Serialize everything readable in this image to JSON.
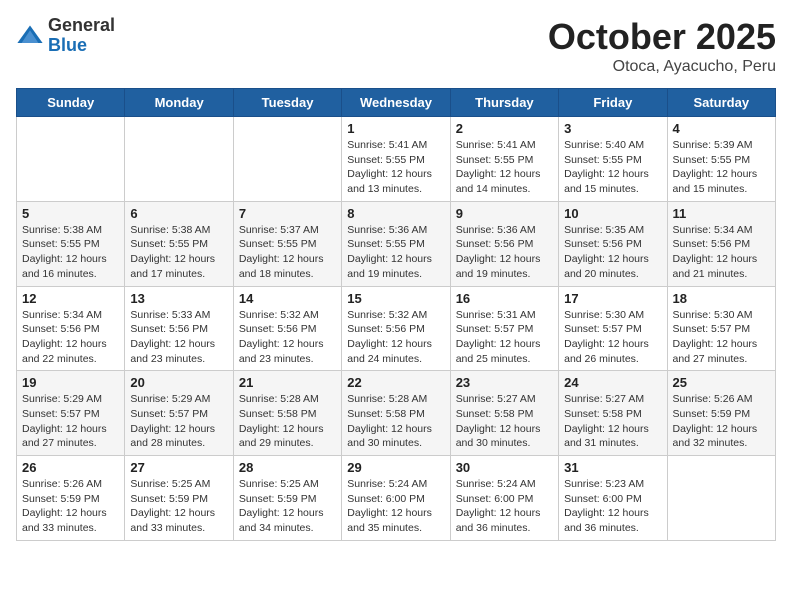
{
  "header": {
    "logo_general": "General",
    "logo_blue": "Blue",
    "title": "October 2025",
    "subtitle": "Otoca, Ayacucho, Peru"
  },
  "weekdays": [
    "Sunday",
    "Monday",
    "Tuesday",
    "Wednesday",
    "Thursday",
    "Friday",
    "Saturday"
  ],
  "weeks": [
    [
      {
        "day": "",
        "info": ""
      },
      {
        "day": "",
        "info": ""
      },
      {
        "day": "",
        "info": ""
      },
      {
        "day": "1",
        "info": "Sunrise: 5:41 AM\nSunset: 5:55 PM\nDaylight: 12 hours\nand 13 minutes."
      },
      {
        "day": "2",
        "info": "Sunrise: 5:41 AM\nSunset: 5:55 PM\nDaylight: 12 hours\nand 14 minutes."
      },
      {
        "day": "3",
        "info": "Sunrise: 5:40 AM\nSunset: 5:55 PM\nDaylight: 12 hours\nand 15 minutes."
      },
      {
        "day": "4",
        "info": "Sunrise: 5:39 AM\nSunset: 5:55 PM\nDaylight: 12 hours\nand 15 minutes."
      }
    ],
    [
      {
        "day": "5",
        "info": "Sunrise: 5:38 AM\nSunset: 5:55 PM\nDaylight: 12 hours\nand 16 minutes."
      },
      {
        "day": "6",
        "info": "Sunrise: 5:38 AM\nSunset: 5:55 PM\nDaylight: 12 hours\nand 17 minutes."
      },
      {
        "day": "7",
        "info": "Sunrise: 5:37 AM\nSunset: 5:55 PM\nDaylight: 12 hours\nand 18 minutes."
      },
      {
        "day": "8",
        "info": "Sunrise: 5:36 AM\nSunset: 5:55 PM\nDaylight: 12 hours\nand 19 minutes."
      },
      {
        "day": "9",
        "info": "Sunrise: 5:36 AM\nSunset: 5:56 PM\nDaylight: 12 hours\nand 19 minutes."
      },
      {
        "day": "10",
        "info": "Sunrise: 5:35 AM\nSunset: 5:56 PM\nDaylight: 12 hours\nand 20 minutes."
      },
      {
        "day": "11",
        "info": "Sunrise: 5:34 AM\nSunset: 5:56 PM\nDaylight: 12 hours\nand 21 minutes."
      }
    ],
    [
      {
        "day": "12",
        "info": "Sunrise: 5:34 AM\nSunset: 5:56 PM\nDaylight: 12 hours\nand 22 minutes."
      },
      {
        "day": "13",
        "info": "Sunrise: 5:33 AM\nSunset: 5:56 PM\nDaylight: 12 hours\nand 23 minutes."
      },
      {
        "day": "14",
        "info": "Sunrise: 5:32 AM\nSunset: 5:56 PM\nDaylight: 12 hours\nand 23 minutes."
      },
      {
        "day": "15",
        "info": "Sunrise: 5:32 AM\nSunset: 5:56 PM\nDaylight: 12 hours\nand 24 minutes."
      },
      {
        "day": "16",
        "info": "Sunrise: 5:31 AM\nSunset: 5:57 PM\nDaylight: 12 hours\nand 25 minutes."
      },
      {
        "day": "17",
        "info": "Sunrise: 5:30 AM\nSunset: 5:57 PM\nDaylight: 12 hours\nand 26 minutes."
      },
      {
        "day": "18",
        "info": "Sunrise: 5:30 AM\nSunset: 5:57 PM\nDaylight: 12 hours\nand 27 minutes."
      }
    ],
    [
      {
        "day": "19",
        "info": "Sunrise: 5:29 AM\nSunset: 5:57 PM\nDaylight: 12 hours\nand 27 minutes."
      },
      {
        "day": "20",
        "info": "Sunrise: 5:29 AM\nSunset: 5:57 PM\nDaylight: 12 hours\nand 28 minutes."
      },
      {
        "day": "21",
        "info": "Sunrise: 5:28 AM\nSunset: 5:58 PM\nDaylight: 12 hours\nand 29 minutes."
      },
      {
        "day": "22",
        "info": "Sunrise: 5:28 AM\nSunset: 5:58 PM\nDaylight: 12 hours\nand 30 minutes."
      },
      {
        "day": "23",
        "info": "Sunrise: 5:27 AM\nSunset: 5:58 PM\nDaylight: 12 hours\nand 30 minutes."
      },
      {
        "day": "24",
        "info": "Sunrise: 5:27 AM\nSunset: 5:58 PM\nDaylight: 12 hours\nand 31 minutes."
      },
      {
        "day": "25",
        "info": "Sunrise: 5:26 AM\nSunset: 5:59 PM\nDaylight: 12 hours\nand 32 minutes."
      }
    ],
    [
      {
        "day": "26",
        "info": "Sunrise: 5:26 AM\nSunset: 5:59 PM\nDaylight: 12 hours\nand 33 minutes."
      },
      {
        "day": "27",
        "info": "Sunrise: 5:25 AM\nSunset: 5:59 PM\nDaylight: 12 hours\nand 33 minutes."
      },
      {
        "day": "28",
        "info": "Sunrise: 5:25 AM\nSunset: 5:59 PM\nDaylight: 12 hours\nand 34 minutes."
      },
      {
        "day": "29",
        "info": "Sunrise: 5:24 AM\nSunset: 6:00 PM\nDaylight: 12 hours\nand 35 minutes."
      },
      {
        "day": "30",
        "info": "Sunrise: 5:24 AM\nSunset: 6:00 PM\nDaylight: 12 hours\nand 36 minutes."
      },
      {
        "day": "31",
        "info": "Sunrise: 5:23 AM\nSunset: 6:00 PM\nDaylight: 12 hours\nand 36 minutes."
      },
      {
        "day": "",
        "info": ""
      }
    ]
  ]
}
